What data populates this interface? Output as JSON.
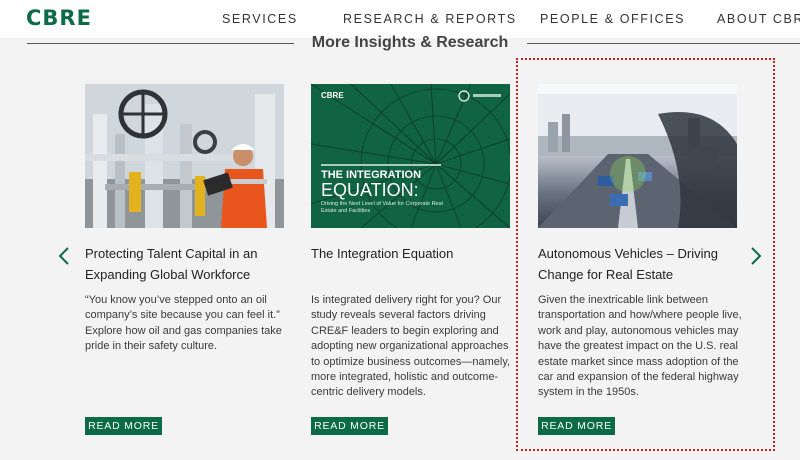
{
  "header": {
    "logo": "CBRE",
    "nav": [
      "SERVICES",
      "RESEARCH & REPORTS",
      "PEOPLE & OFFICES",
      "ABOUT CBRE"
    ]
  },
  "section": {
    "title": "More Insights & Research"
  },
  "cards": [
    {
      "title": "Protecting Talent Capital in an Expanding Global Workforce",
      "body": "“You know you’ve stepped onto an oil company’s site because you can feel it.” Explore how oil and gas companies take pride in their safety culture.",
      "button": "READ MORE",
      "image": "oil-rig-worker-photo"
    },
    {
      "title": "The Integration Equation",
      "body": "Is integrated delivery right for you? Our study reveals several factors driving CRE&F leaders to begin exploring and adopting new organizational approaches to optimize business outcomes—namely, more integrated, holistic and outcome-centric delivery models.",
      "button": "READ MORE",
      "image": "report-cover",
      "cover": {
        "brand": "CBRE",
        "headline_1": "THE INTEGRATION",
        "headline_2": "EQUATION:",
        "subhead": "Driving the Next Level of Value for Corporate Real Estate and Facilities"
      }
    },
    {
      "title": "Autonomous Vehicles – Driving Change for Real Estate",
      "body": "Given the inextricable link between transportation and how/where people live, work and play, autonomous vehicles may have the greatest impact on the U.S. real estate market since mass adoption of the car and expansion of the federal highway system in the 1950s.",
      "button": "READ MORE",
      "image": "autonomous-car-photo"
    }
  ],
  "carousel": {
    "prev_icon": "chevron-left-icon",
    "next_icon": "chevron-right-icon"
  },
  "colors": {
    "brand": "#0c6b47",
    "background": "#f3f3f3",
    "highlight": "#d21b1b"
  }
}
